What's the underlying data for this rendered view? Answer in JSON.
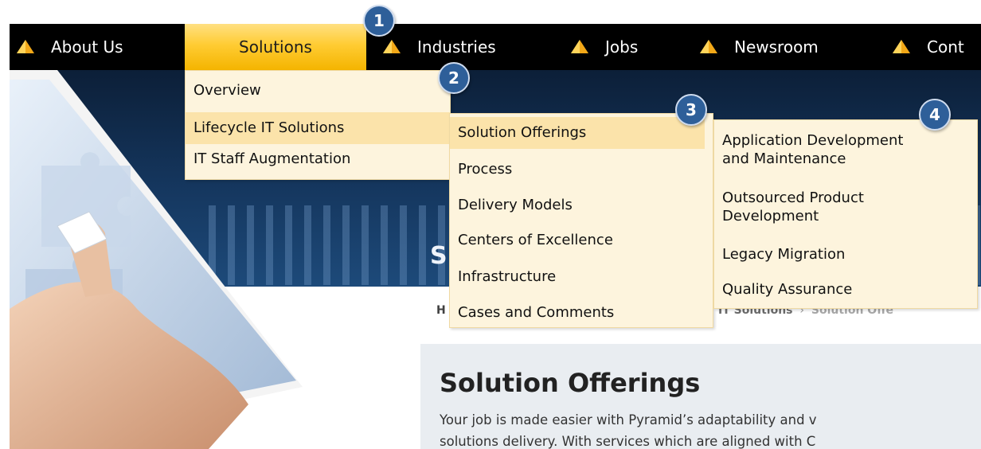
{
  "nav": {
    "items": [
      {
        "label": "About Us",
        "icon": "pyramid-icon"
      },
      {
        "label": "Solutions",
        "active": true
      },
      {
        "label": "Industries",
        "icon": "pyramid-icon"
      },
      {
        "label": "Jobs",
        "icon": "pyramid-icon"
      },
      {
        "label": "Newsroom",
        "icon": "pyramid-icon"
      },
      {
        "label": "Cont",
        "icon": "pyramid-icon"
      }
    ]
  },
  "menus": {
    "solutions": [
      "Overview",
      "Lifecycle IT Solutions",
      "IT Staff Augmentation"
    ],
    "lifecycle": [
      "Solution Offerings",
      "Process",
      "Delivery Models",
      "Centers of Excellence",
      "Infrastructure",
      "Cases and Comments"
    ],
    "offerings": [
      {
        "line1": "Application Development",
        "line2": "and Maintenance"
      },
      {
        "line1": "Outsourced Product",
        "line2": "Development"
      },
      {
        "line1": "Legacy Migration"
      },
      {
        "line1": "Quality Assurance"
      }
    ]
  },
  "hero": {
    "heading_fragment": "S"
  },
  "breadcrumb": {
    "home": "H",
    "parent": "IT Solutions",
    "separator": "›",
    "current": "Solution Offe"
  },
  "content": {
    "title": "Solution Offerings",
    "line1": "Your job is made easier with Pyramid’s adaptability and v",
    "line2": "solutions delivery. With services which are aligned with C"
  },
  "callouts": [
    "1",
    "2",
    "3",
    "4"
  ],
  "colors": {
    "nav_bg": "#000000",
    "active_tab": "#ffcc33",
    "menu_bg": "#fdf4dd",
    "menu_highlight": "#fbe3aa",
    "callout": "#2e5f99",
    "pyramid_icon": "#f2a818"
  }
}
